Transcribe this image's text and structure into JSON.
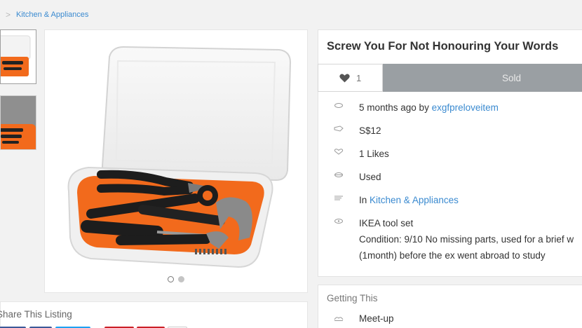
{
  "breadcrumb": {
    "separator": ">",
    "category": "Kitchen & Appliances"
  },
  "gallery": {
    "thumbnails": [
      "thumbnail-1",
      "thumbnail-2"
    ],
    "active_dot": 0,
    "dot_count": 2
  },
  "share": {
    "title": "Share This Listing"
  },
  "listing": {
    "title": "Screw You For Not Honouring Your Words",
    "likes_count": "1",
    "status_label": "Sold",
    "posted": "5 months ago by",
    "seller": "exgfpreloveitem",
    "price": "S$12",
    "likes_text": "1 Likes",
    "condition": "Used",
    "category_prefix": "In",
    "category": "Kitchen & Appliances",
    "description_lines": [
      "IKEA tool set",
      "Condition: 9/10 No missing parts, used for a brief w",
      "(1month) before the ex went abroad to study"
    ]
  },
  "getting": {
    "title": "Getting This",
    "method": "Meet-up"
  },
  "colors": {
    "link": "#3a8ad0",
    "sold_bg": "#9a9fa3",
    "orange": "#f26a1c"
  }
}
